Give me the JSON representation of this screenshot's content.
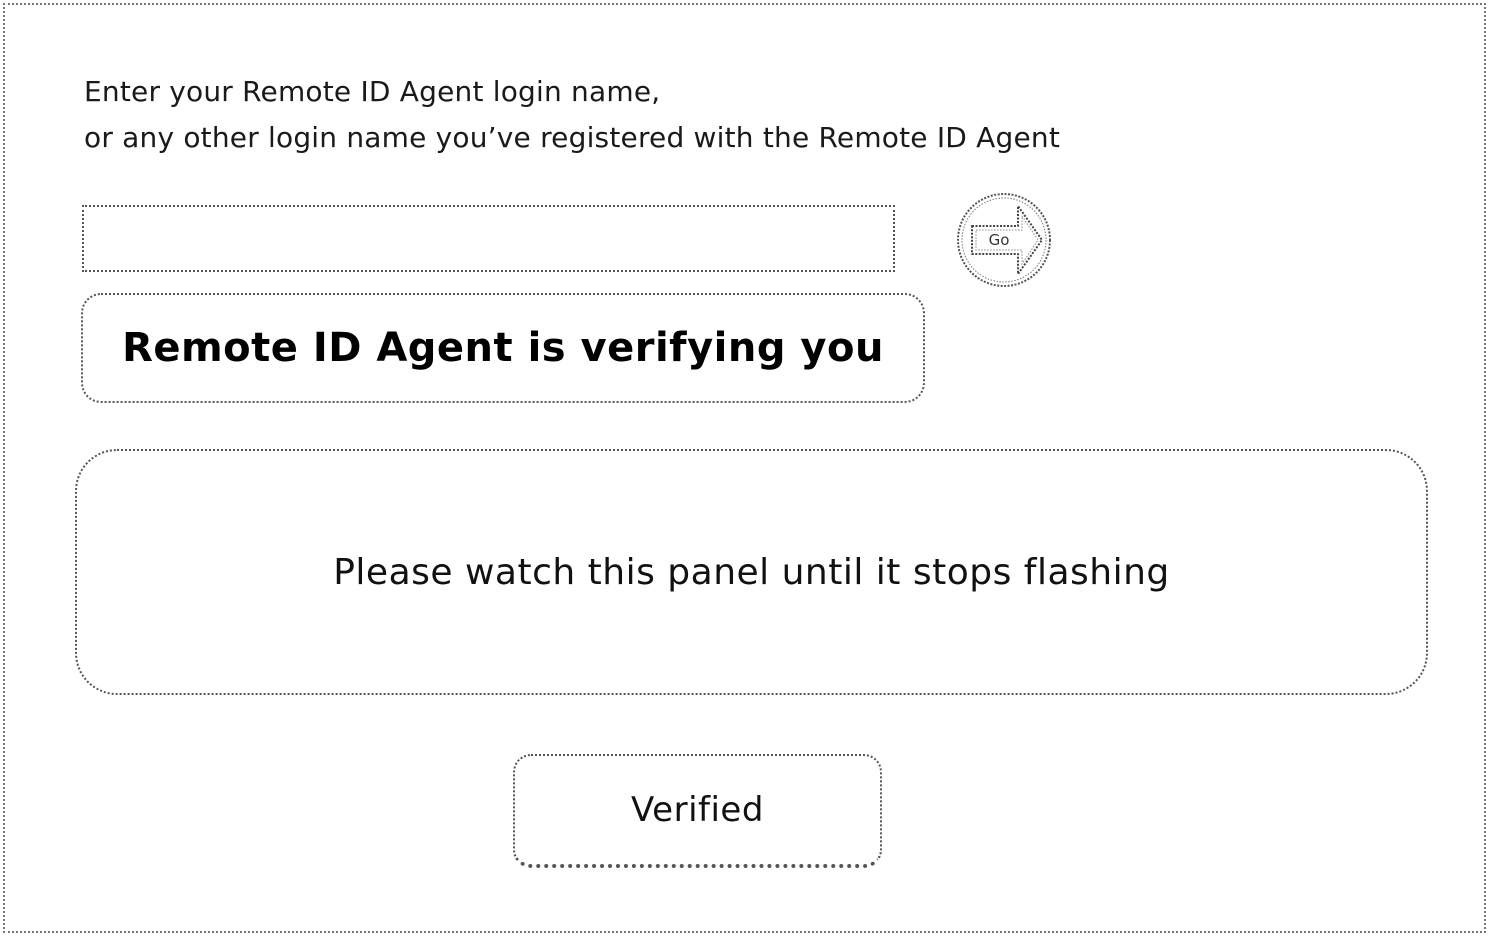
{
  "instructions": {
    "line1": "Enter your Remote ID Agent login name,",
    "line2": "or any other login name you’ve registered with the Remote ID Agent"
  },
  "login": {
    "value": "",
    "placeholder": ""
  },
  "go_button": {
    "label": "Go",
    "icon": "arrow-right-icon"
  },
  "status": {
    "text": "Remote ID Agent is verifying you"
  },
  "panel": {
    "message": "Please watch this panel until it stops flashing"
  },
  "verified_button": {
    "label": "Verified"
  }
}
